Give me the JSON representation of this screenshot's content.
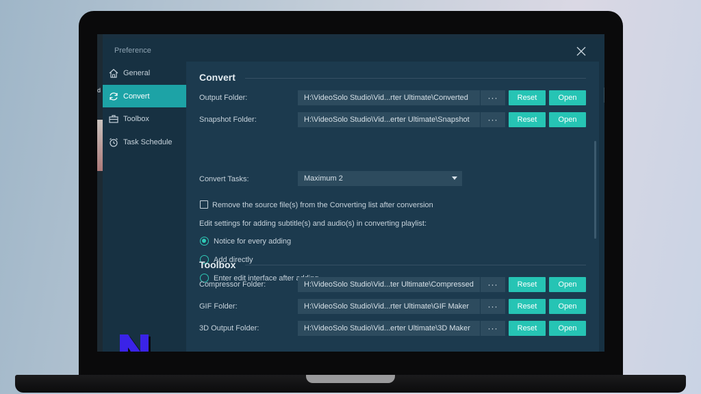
{
  "dialog": {
    "title": "Preference"
  },
  "sidebar": {
    "items": [
      {
        "label": "General",
        "icon": "home-icon",
        "active": false
      },
      {
        "label": "Convert",
        "icon": "refresh-icon",
        "active": true
      },
      {
        "label": "Toolbox",
        "icon": "toolbox-icon",
        "active": false
      },
      {
        "label": "Task Schedule",
        "icon": "alarm-clock-icon",
        "active": false
      }
    ],
    "logo_icon": "n-logo-icon"
  },
  "background": {
    "partial_letter": "d"
  },
  "convert": {
    "title": "Convert",
    "output": {
      "label": "Output Folder:",
      "path": "H:\\VideoSolo Studio\\Vid...rter Ultimate\\Converted",
      "dots": "···",
      "reset": "Reset",
      "open": "Open"
    },
    "snapshot": {
      "label": "Snapshot Folder:",
      "path": "H:\\VideoSolo Studio\\Vid...erter Ultimate\\Snapshot",
      "dots": "···",
      "reset": "Reset",
      "open": "Open"
    },
    "tasks": {
      "label": "Convert Tasks:",
      "value": "Maximum 2"
    },
    "remove_source": {
      "label": "Remove the source file(s) from the Converting list after conversion",
      "checked": false
    },
    "edit_settings_label": "Edit settings for adding subtitle(s) and audio(s) in converting playlist:",
    "options": [
      {
        "label": "Notice for every adding",
        "checked": true
      },
      {
        "label": "Add directly",
        "checked": false
      },
      {
        "label": "Enter edit interface after adding",
        "checked": false
      }
    ]
  },
  "toolbox": {
    "title": "Toolbox",
    "compressor": {
      "label": "Compressor Folder:",
      "path": "H:\\VideoSolo Studio\\Vid...ter Ultimate\\Compressed",
      "dots": "···",
      "reset": "Reset",
      "open": "Open"
    },
    "gif": {
      "label": "GIF Folder:",
      "path": "H:\\VideoSolo Studio\\Vid...rter Ultimate\\GIF Maker",
      "dots": "···",
      "reset": "Reset",
      "open": "Open"
    },
    "output3d": {
      "label": "3D Output Folder:",
      "path": "H:\\VideoSolo Studio\\Vid...erter Ultimate\\3D Maker",
      "dots": "···",
      "reset": "Reset",
      "open": "Open"
    }
  },
  "colors": {
    "accent": "#26c4b4",
    "sidebar_active": "#1da3a6",
    "dialog_bg": "#173142",
    "content_bg": "#1c3a4e",
    "field_bg": "#2d4b5e",
    "logo_blue": "#3a23e8"
  }
}
